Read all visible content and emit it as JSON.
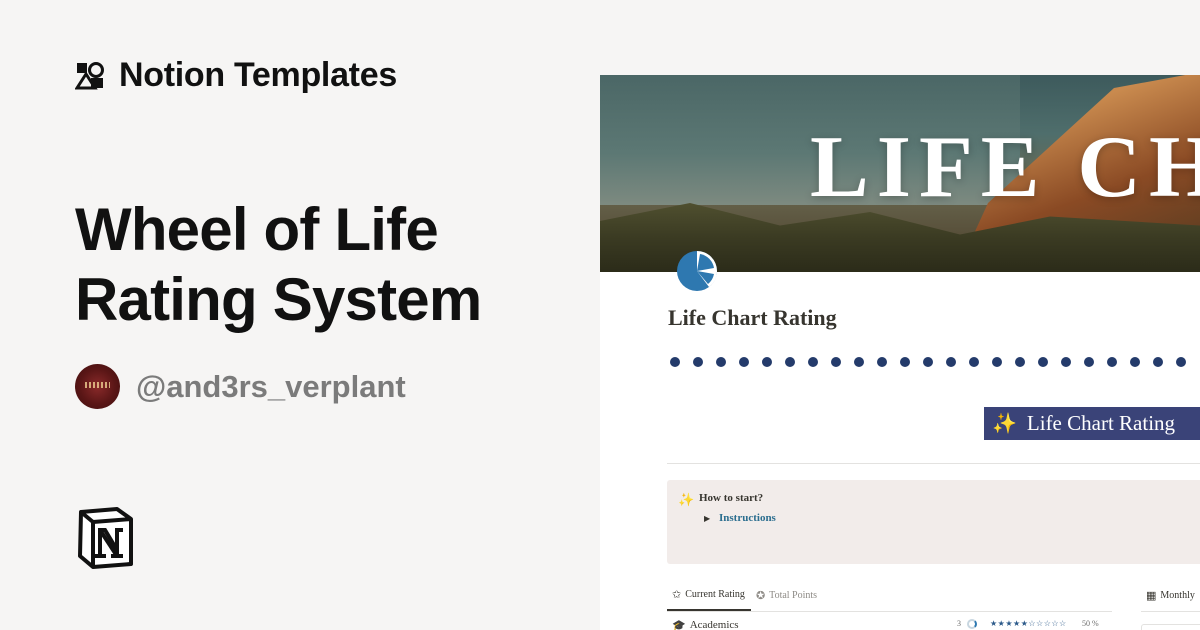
{
  "brand": {
    "name": "Notion Templates",
    "icon": "notion-templates-shapes-icon"
  },
  "headline": "Wheel of Life Rating System",
  "author": {
    "handle": "@and3rs_verplant",
    "avatar": "author-avatar"
  },
  "notion_logo": "notion-logo-icon",
  "preview": {
    "cover_text": "LIFE CH",
    "page_icon": "pie-chart-icon",
    "page_title": "Life Chart Rating",
    "dot_count": 23,
    "banner": {
      "icon": "sparkles-icon",
      "text": "Life Chart Rating"
    },
    "callout": {
      "icon": "sparkles-icon",
      "title": "How to start?",
      "toggle_icon": "triangle-right-icon",
      "link": "Instructions"
    },
    "tabs": [
      {
        "label": "Current Rating",
        "icon": "star-outline-icon",
        "active": true
      },
      {
        "label": "Total Points",
        "icon": "star-circle-icon",
        "active": false
      }
    ],
    "side_tab": {
      "label": "Monthly",
      "icon": "grid-icon"
    },
    "rows": [
      {
        "icon": "graduation-cap-icon",
        "label": "Academics",
        "score": "3",
        "stars": "★★★★★☆☆☆☆☆",
        "percent": "50 %"
      }
    ],
    "colors": {
      "banner_bg": "#3a4378",
      "dot": "#243b6b",
      "callout_bg": "#f2ecea",
      "link": "#2c6e8f"
    }
  }
}
